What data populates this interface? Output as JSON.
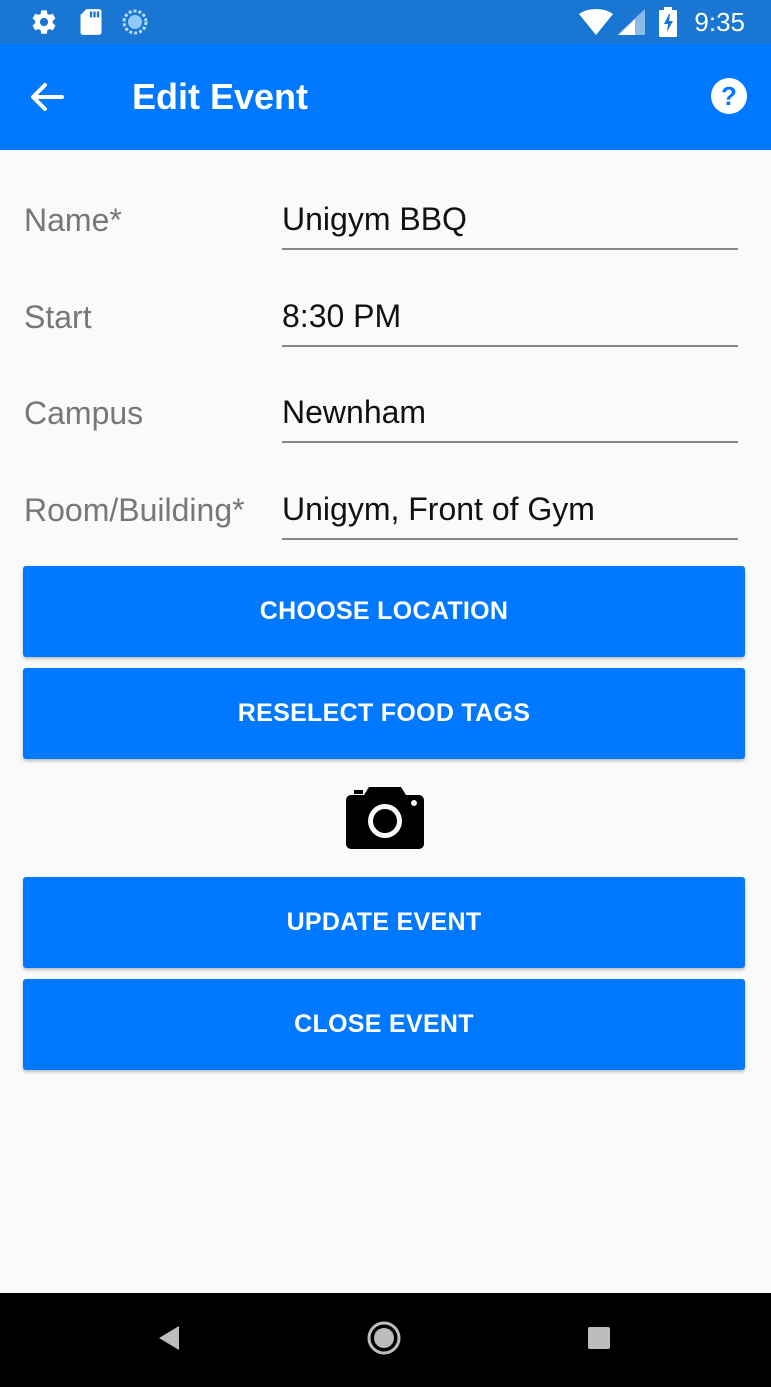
{
  "status_bar": {
    "time": "9:35",
    "icons": [
      "settings-icon",
      "sd-card-icon",
      "sync-icon",
      "wifi-icon",
      "signal-icon",
      "battery-icon"
    ]
  },
  "app_bar": {
    "title": "Edit Event",
    "back_icon": "arrow-left-icon",
    "help_icon": "help-circle-icon",
    "background": "#0078ff"
  },
  "form": {
    "name": {
      "label": "Name*",
      "value": "Unigym BBQ"
    },
    "start": {
      "label": "Start",
      "value": "8:30 PM"
    },
    "campus": {
      "label": "Campus",
      "value": "Newnham"
    },
    "room": {
      "label": "Room/Building*",
      "value": "Unigym, Front of Gym"
    }
  },
  "buttons": {
    "choose_location": "CHOOSE LOCATION",
    "reselect_food_tags": "RESELECT FOOD TAGS",
    "camera_icon": "camera-icon",
    "update_event": "UPDATE EVENT",
    "close_event": "CLOSE EVENT"
  },
  "nav_bar": {
    "icons": [
      "back-triangle-icon",
      "home-circle-icon",
      "recents-square-icon"
    ]
  },
  "colors": {
    "accent": "#0078ff",
    "status_bar": "#1976d2",
    "background": "#fafafa"
  }
}
